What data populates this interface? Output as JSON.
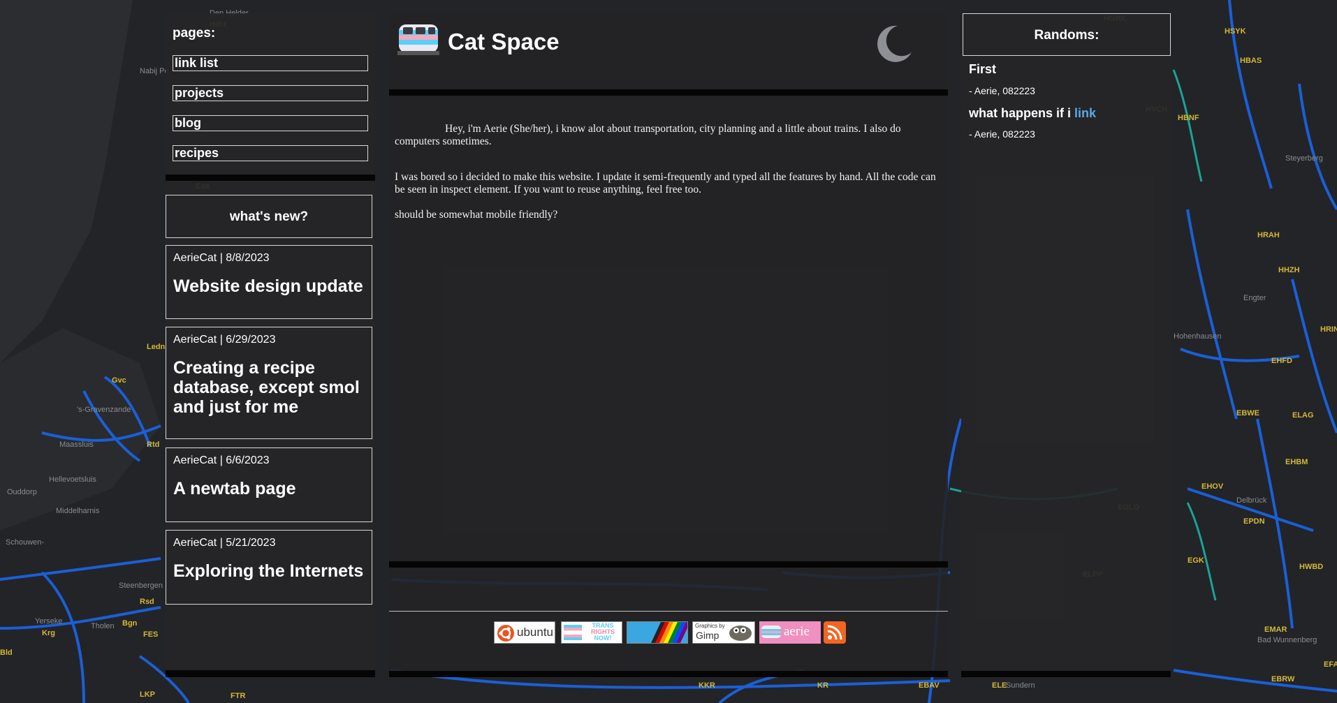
{
  "nav": {
    "title": "pages:",
    "links": [
      "link list",
      "projects",
      "blog",
      "recipes"
    ]
  },
  "news": {
    "heading": "what's new?",
    "posts": [
      {
        "meta": "AerieCat | 8/8/2023",
        "title": "Website design update"
      },
      {
        "meta": "AerieCat | 6/29/2023",
        "title": "Creating a recipe database, except smol and just for me"
      },
      {
        "meta": "AerieCat | 6/6/2023",
        "title": "A newtab page"
      },
      {
        "meta": "AerieCat | 5/21/2023",
        "title": "Exploring the Internets"
      }
    ]
  },
  "header": {
    "title": "Cat Space"
  },
  "main": {
    "para1": "Hey, i'm Aerie (She/her), i know alot about transportation, city planning and a little about trains. I also do computers sometimes.",
    "para2": "I was bored so i decided to make this website. I update it semi-frequently and typed all the features by hand. All the code can be seen in inspect element. If you want to reuse anything, feel free too.",
    "para3": "should be somewhat mobile friendly?"
  },
  "badges": {
    "ubuntu": "ubuntu",
    "trans1": "TRANS",
    "trans2": "RIGHTS",
    "trans3": "NOW!",
    "gimp1": "Graphics by",
    "gimp2": "Gimp",
    "aerie": "aerie"
  },
  "randoms": {
    "heading": "Randoms:",
    "items": [
      {
        "title": "First",
        "sub": "- Aerie, 082223"
      },
      {
        "title": "what happens if i ",
        "link": "link",
        "sub": "- Aerie, 082223"
      }
    ]
  },
  "colors": {
    "rail_blue": "#1a5fd8",
    "rail_teal": "#1aa39a",
    "station_yellow": "#e0c23a",
    "link": "#5aa9e6"
  }
}
